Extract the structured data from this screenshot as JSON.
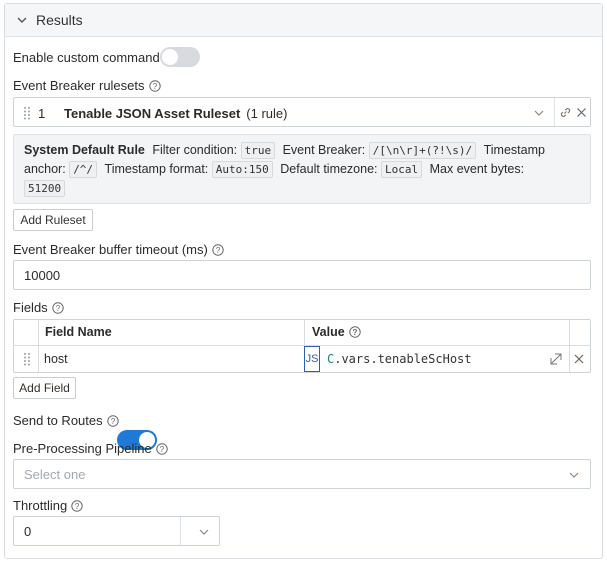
{
  "section": {
    "title": "Results"
  },
  "custom_command": {
    "label": "Enable custom command",
    "enabled": false
  },
  "event_breaker": {
    "label": "Event Breaker rulesets",
    "row": {
      "index": "1",
      "name": "Tenable JSON Asset Ruleset",
      "rule_count": "(1 rule)"
    },
    "rule": {
      "name": "System Default Rule",
      "filter_label": "Filter condition:",
      "filter_value": "true",
      "breaker_label": "Event Breaker:",
      "breaker_value": "/[\\n\\r]+(?!\\s)/",
      "timestamp_anchor_label_a": "Timestamp",
      "timestamp_anchor_label_b": "anchor:",
      "timestamp_anchor_value": "/^/",
      "timestamp_format_label": "Timestamp format:",
      "timestamp_format_value": "Auto:150",
      "timezone_label": "Default timezone:",
      "timezone_value": "Local",
      "max_bytes_label": "Max event bytes:",
      "max_bytes_value": "51200"
    },
    "add_button": "Add Ruleset"
  },
  "buffer_timeout": {
    "label": "Event Breaker buffer timeout (ms)",
    "value": "10000"
  },
  "fields": {
    "label": "Fields",
    "headers": {
      "name": "Field Name",
      "value": "Value"
    },
    "rows": [
      {
        "name": "host",
        "type": "JS",
        "value": "C.vars.tenableScHost"
      }
    ],
    "add_button": "Add Field"
  },
  "send_to_routes": {
    "label": "Send to Routes",
    "enabled": true
  },
  "pipeline": {
    "label": "Pre-Processing Pipeline",
    "placeholder": "Select one"
  },
  "throttling": {
    "label": "Throttling",
    "value": "0"
  },
  "colors": {
    "accent": "#1e7ad6",
    "js_badge_border": "#2c5fb3",
    "value_code_prefix": "#1a8a5a"
  },
  "icons": [
    "chevron-down-icon",
    "help-icon",
    "drag-handle-icon",
    "link-icon",
    "close-icon",
    "expand-icon"
  ]
}
